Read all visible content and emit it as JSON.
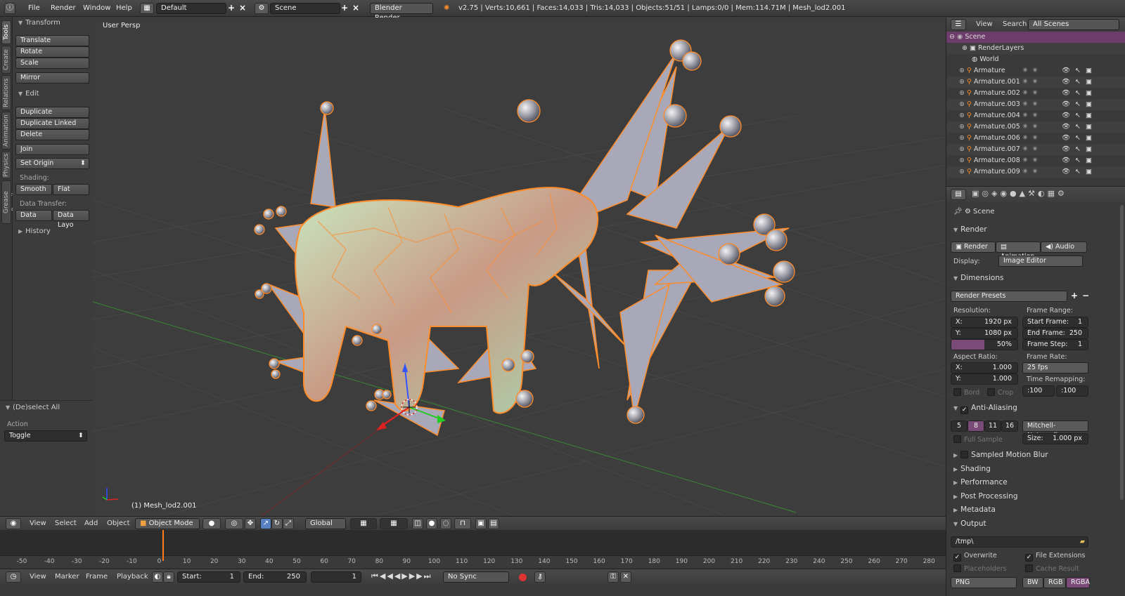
{
  "topbar": {
    "menus": [
      "File",
      "Render",
      "Window",
      "Help"
    ],
    "layout": "Default",
    "scene": "Scene",
    "engine": "Blender Render",
    "stats": "v2.75 | Verts:10,661 | Faces:14,033 | Tris:14,033 | Objects:51/51 | Lamps:0/0 | Mem:114.71M | Mesh_lod2.001"
  },
  "vtabs": [
    "Tools",
    "Create",
    "Relations",
    "Animation",
    "Physics",
    "Grease Pencil"
  ],
  "toolshelf": {
    "transform_title": "Transform",
    "translate": "Translate",
    "rotate": "Rotate",
    "scale": "Scale",
    "mirror": "Mirror",
    "edit_title": "Edit",
    "duplicate": "Duplicate",
    "duplicate_linked": "Duplicate Linked",
    "delete": "Delete",
    "join": "Join",
    "set_origin": "Set Origin",
    "shading_label": "Shading:",
    "smooth": "Smooth",
    "flat": "Flat",
    "data_transfer_label": "Data Transfer:",
    "data": "Data",
    "data_layo": "Data Layo",
    "history": "History"
  },
  "operator": {
    "title": "(De)select All",
    "action_label": "Action",
    "action_value": "Toggle"
  },
  "viewport": {
    "label": "User Persp",
    "object_label": "(1) Mesh_lod2.001"
  },
  "vp_header": {
    "view": "View",
    "select": "Select",
    "add": "Add",
    "object": "Object",
    "mode": "Object Mode",
    "orientation": "Global"
  },
  "timeline": {
    "ticks": [
      "-50",
      "-40",
      "-30",
      "-20",
      "-10",
      "0",
      "10",
      "20",
      "30",
      "40",
      "50",
      "60",
      "70",
      "80",
      "90",
      "100",
      "110",
      "120",
      "130",
      "140",
      "150",
      "160",
      "170",
      "180",
      "190",
      "200",
      "210",
      "220",
      "230",
      "240",
      "250",
      "260",
      "270",
      "280"
    ],
    "current_frame": 1
  },
  "tl_header": {
    "view": "View",
    "marker": "Marker",
    "frame": "Frame",
    "playback": "Playback",
    "start": "Start:",
    "start_val": "1",
    "end": "End:",
    "end_val": "250",
    "current": "1",
    "sync": "No Sync"
  },
  "outliner": {
    "view": "View",
    "search": "Search",
    "filter": "All Scenes",
    "scene": "Scene",
    "renderlayers": "RenderLayers",
    "world": "World",
    "items": [
      "Armature",
      "Armature.001",
      "Armature.002",
      "Armature.003",
      "Armature.004",
      "Armature.005",
      "Armature.006",
      "Armature.007",
      "Armature.008",
      "Armature.009"
    ]
  },
  "props": {
    "context": "Scene",
    "render_title": "Render",
    "render_btn": "Render",
    "animation_btn": "Animation",
    "audio_btn": "Audio",
    "display_label": "Display:",
    "display_val": "Image Editor",
    "dimensions_title": "Dimensions",
    "render_presets": "Render Presets",
    "resolution_label": "Resolution:",
    "res_x": "X:",
    "res_x_val": "1920 px",
    "res_y": "Y:",
    "res_y_val": "1080 px",
    "res_pct": "50%",
    "res_pct_value": 0.5,
    "frame_range_label": "Frame Range:",
    "start_frame": "Start Frame:",
    "start_frame_val": "1",
    "end_frame": "End Frame:",
    "end_frame_val": "250",
    "frame_step": "Frame Step:",
    "frame_step_val": "1",
    "aspect_label": "Aspect Ratio:",
    "asp_x": "X:",
    "asp_x_val": "1.000",
    "asp_y": "Y:",
    "asp_y_val": "1.000",
    "frame_rate_label": "Frame Rate:",
    "fps": "25 fps",
    "time_remap_label": "Time Remapping:",
    "remap_old": ":100",
    "remap_new": ":100",
    "bord": "Bord",
    "crop": "Crop",
    "aa_title": "Anti-Aliasing",
    "aa_samples": [
      "5",
      "8",
      "11",
      "16"
    ],
    "aa_filter": "Mitchell-Netravali",
    "full_sample": "Full Sample",
    "aa_size_label": "Size:",
    "aa_size": "1.000 px",
    "motion_blur": "Sampled Motion Blur",
    "shading": "Shading",
    "performance": "Performance",
    "post_processing": "Post Processing",
    "metadata": "Metadata",
    "output_title": "Output",
    "output_path": "/tmp\\",
    "overwrite": "Overwrite",
    "file_ext": "File Extensions",
    "placeholders": "Placeholders",
    "cache_result": "Cache Result",
    "format": "PNG",
    "bw": "BW",
    "rgb": "RGB",
    "rgba": "RGBA"
  },
  "colors": {
    "accent_orange": "#ff8c2a",
    "selection_purple": "#8a4a84",
    "bg": "#3a3a3a",
    "viewport_bg": "#3d3d3d"
  }
}
